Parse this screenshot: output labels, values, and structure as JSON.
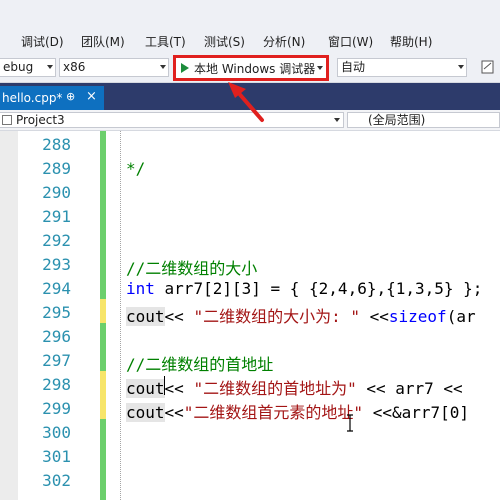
{
  "menu": {
    "items": [
      "调试(D)",
      "团队(M)",
      "工具(T)",
      "测试(S)",
      "分析(N)",
      "窗口(W)",
      "帮助(H)"
    ]
  },
  "toolbar": {
    "config": "ebug",
    "platform": "x86",
    "run_label": "本地 Windows 调试器",
    "auto": "自动"
  },
  "tab": {
    "label": "hello.cpp*",
    "pin": "⊕",
    "close": "×"
  },
  "navbar": {
    "project": "Project3",
    "scope": "(全局范围)"
  },
  "editor": {
    "line_numbers": [
      "288",
      "289",
      "290",
      "291",
      "292",
      "293",
      "294",
      "295",
      "296",
      "297",
      "298",
      "299",
      "300",
      "301",
      "302"
    ],
    "lines": {
      "l289": "*/",
      "l293": "//二维数组的大小",
      "l294_kw": "int",
      "l294_rest": " arr7[2][3] = { {2,4,6},{1,3,5} };",
      "l295_cout": "cout",
      "l295_op": "<< ",
      "l295_str": "\"二维数组的大小为: \"",
      "l295_op2": " <<",
      "l295_kw": "sizeof",
      "l295_rest": "(ar",
      "l297": "//二维数组的首地址",
      "l298_cout": "cout",
      "l298_op": "<< ",
      "l298_str": "\"二维数组的首地址为\"",
      "l298_rest": " << arr7 <<",
      "l299_cout": "cout",
      "l299_op": "<<",
      "l299_str": "\"二维数组首元素的地址\"",
      "l299_rest": " <<&arr7[0]"
    }
  },
  "colors": {
    "accent": "#0e70c0",
    "highlight_box": "#e0201e",
    "change_saved": "#6ccf6c",
    "change_unsaved": "#f7e56a"
  }
}
